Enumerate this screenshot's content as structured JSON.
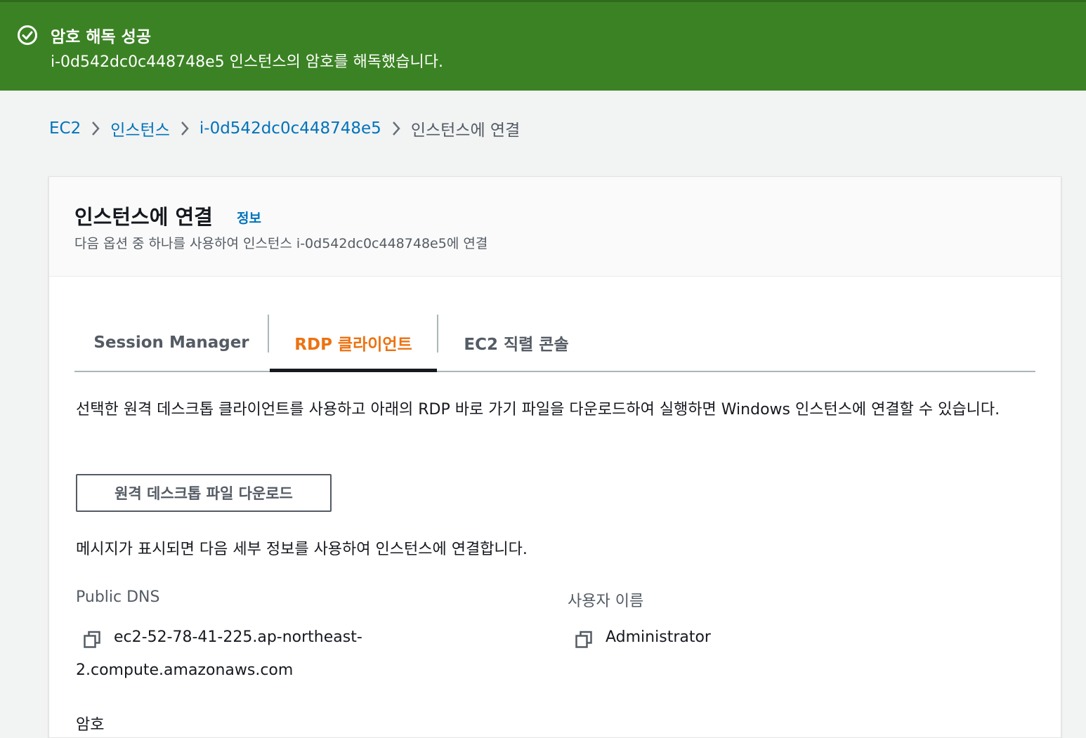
{
  "flash": {
    "icon": "check-circle-icon",
    "title": "암호 해독 성공",
    "message": "i-0d542dc0c448748e5 인스턴스의 암호를 해독했습니다.",
    "color": "#3b8224"
  },
  "breadcrumb": {
    "items": [
      "EC2",
      "인스턴스",
      "i-0d542dc0c448748e5",
      "인스턴스에 연결"
    ],
    "separator_icon": "chevron-right-icon"
  },
  "panel": {
    "title": "인스턴스에 연결",
    "info_link": "정보",
    "description": "다음 옵션 중 하나를 사용하여 인스턴스 i-0d542dc0c448748e5에 연결"
  },
  "tabs": [
    {
      "label": "Session Manager",
      "active": false
    },
    {
      "label": "RDP 클라이언트",
      "active": true
    },
    {
      "label": "EC2 직렬 콘솔",
      "active": false
    }
  ],
  "rdp": {
    "description": "선택한 원격 데스크톱 클라이언트를 사용하고 아래의 RDP 바로 가기 파일을 다운로드하여 실행하면 Windows 인스턴스에 연결할 수 있습니다.",
    "download_button": "원격 데스크톱 파일 다운로드",
    "connect_message": "메시지가 표시되면 다음 세부 정보를 사용하여 인스턴스에 연결합니다.",
    "public_dns_label": "Public DNS",
    "public_dns_line1": "ec2-52-78-41-225.ap-northeast-",
    "public_dns_line2": "2.compute.amazonaws.com",
    "username_label": "사용자 이름",
    "username_value": "Administrator",
    "password_label": "암호",
    "copy_icon": "copy-icon"
  },
  "colors": {
    "link": "#0073bb",
    "active_tab": "#ec7211",
    "success": "#3b8224"
  }
}
